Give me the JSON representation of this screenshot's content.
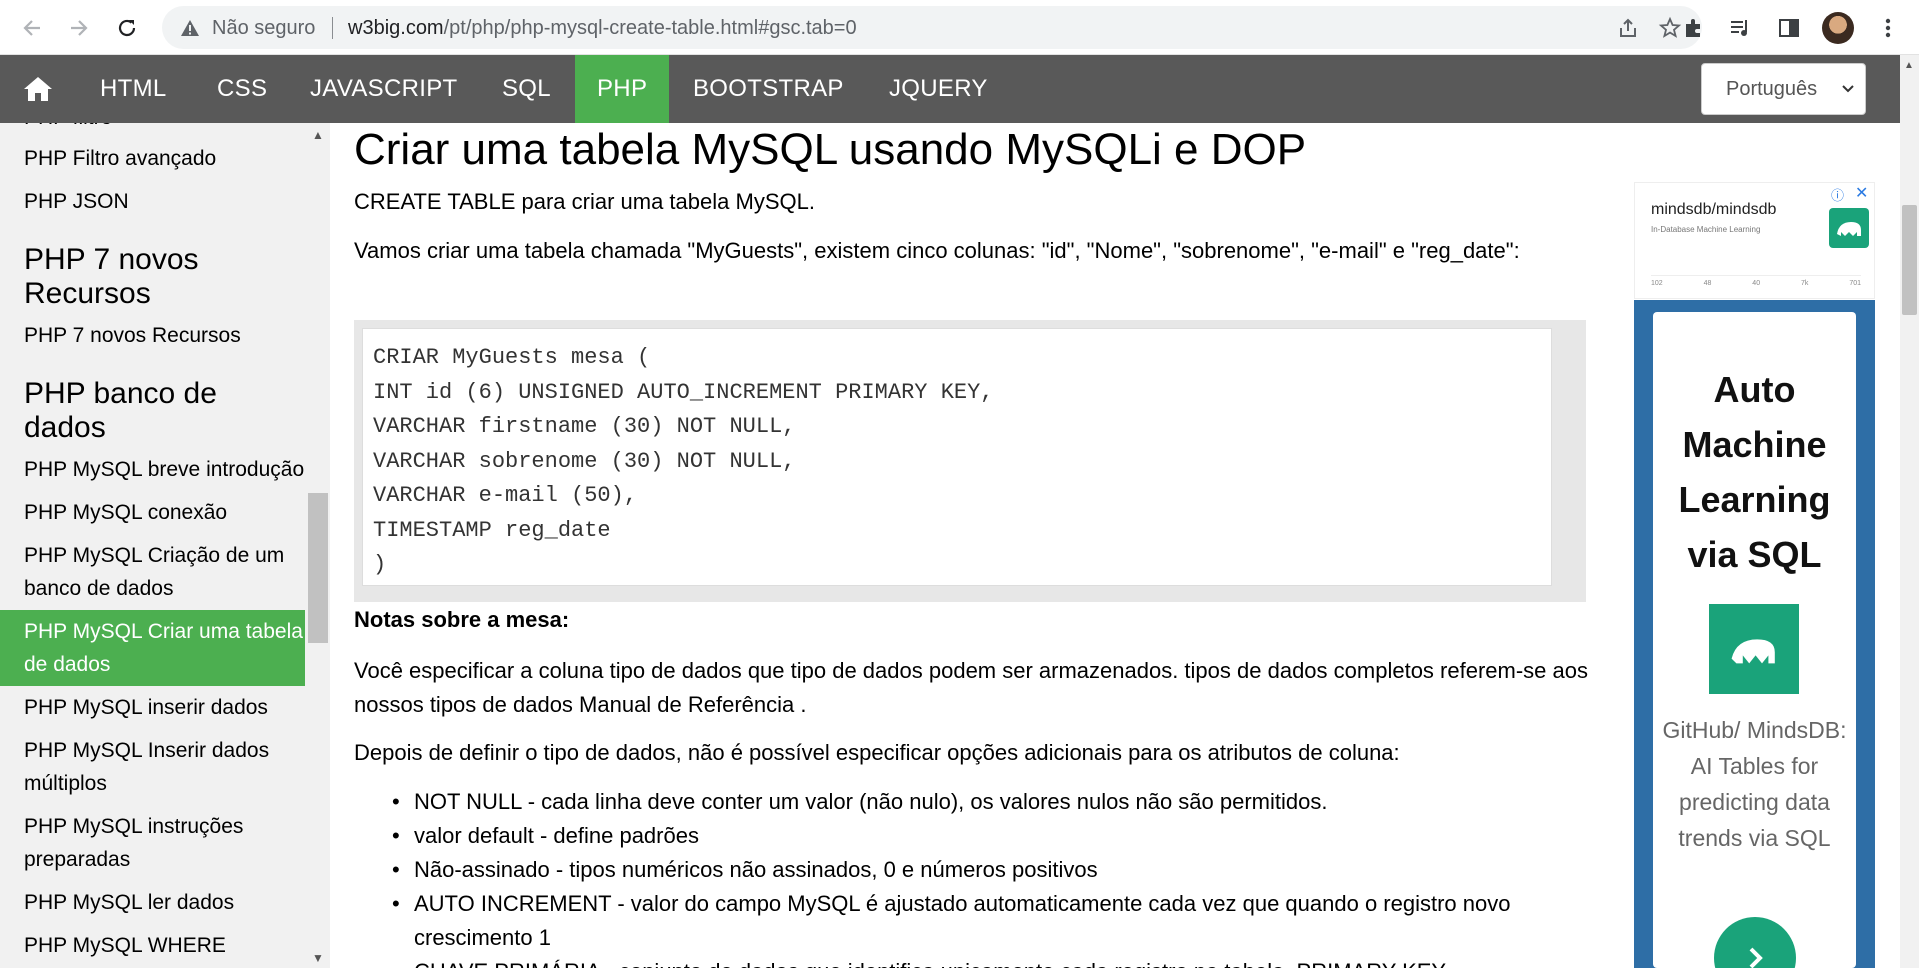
{
  "browser": {
    "security_label": "Não seguro",
    "url_host": "w3big.com",
    "url_path": "/pt/php/php-mysql-create-table.html#gsc.tab=0"
  },
  "topnav": {
    "items": [
      "HTML",
      "CSS",
      "JAVASCRIPT",
      "SQL",
      "PHP",
      "BOOTSTRAP",
      "JQUERY"
    ],
    "active": "PHP",
    "language": "Português"
  },
  "sidebar": {
    "link_filtro": "PHP filtro",
    "link_filtro_avancado": "PHP Filtro avançado",
    "link_json": "PHP JSON",
    "heading_php7": "PHP 7 novos Recursos",
    "link_php7": "PHP 7 novos Recursos",
    "heading_db": "PHP banco de dados",
    "link_intro": "PHP MySQL breve introdução",
    "link_conexao": "PHP MySQL conexão",
    "link_criacao_db": "PHP MySQL Criação de um banco de dados",
    "link_criar_tabela": "PHP MySQL Criar uma tabela de dados",
    "link_inserir": "PHP MySQL inserir dados",
    "link_inserir_multi": "PHP MySQL Inserir dados múltiplos",
    "link_prepared": "PHP MySQL instruções preparadas",
    "link_ler": "PHP MySQL ler dados",
    "link_where": "PHP MySQL WHERE"
  },
  "main": {
    "title": "Criar uma tabela MySQL usando MySQLi e DOP",
    "intro": "CREATE TABLE para criar uma tabela MySQL.",
    "para1": "Vamos criar uma tabela chamada \"MyGuests\", existem cinco colunas: \"id\", \"Nome\", \"sobrenome\", \"e-mail\" e \"reg_date\":",
    "code": {
      "line1": "CRIAR MyGuests mesa (",
      "line2": "INT id (6) UNSIGNED AUTO_INCREMENT PRIMARY KEY,",
      "line3": "VARCHAR firstname (30) NOT NULL,",
      "line4": "VARCHAR sobrenome (30) NOT NULL,",
      "line5": "VARCHAR e-mail (50),",
      "line6": "TIMESTAMP reg_date",
      "line7": ")"
    },
    "notes_title": "Notas sobre a mesa:",
    "para2": "Você especificar a coluna tipo de dados que tipo de dados podem ser armazenados. tipos de dados completos referem-se aos nossos tipos de dados Manual de Referência .",
    "para3": "Depois de definir o tipo de dados, não é possível especificar opções adicionais para os atributos de coluna:",
    "bullets": {
      "b1": "NOT NULL - cada linha deve conter um valor (não nulo), os valores nulos não são permitidos.",
      "b2": "valor default - define padrões",
      "b3": "Não-assinado - tipos numéricos não assinados, 0 e números positivos",
      "b4": "AUTO INCREMENT - valor do campo MySQL é ajustado automaticamente cada vez que quando o registro novo crescimento 1",
      "b5": "CHAVE PRIMÁRIA - conjunto de dados que identifica unicamente cada registro na tabela. PRIMARY KEY"
    }
  },
  "ads": {
    "small_title": "mindsdb/mindsdb",
    "small_subtitle": "In-Database Machine Learning",
    "small_stats": [
      "102",
      "48",
      "40",
      "7k",
      "701"
    ],
    "big_headline": "Auto Machine Learning via SQL",
    "big_text": "GitHub/ MindsDB: AI Tables for predicting data trends via SQL"
  },
  "colors": {
    "accent": "#4caf50",
    "nav_bg": "#595959",
    "sidebar_bg": "#f1f1f1",
    "ad_green": "#1aa37a",
    "ad_blue": "#2e6ea6"
  }
}
